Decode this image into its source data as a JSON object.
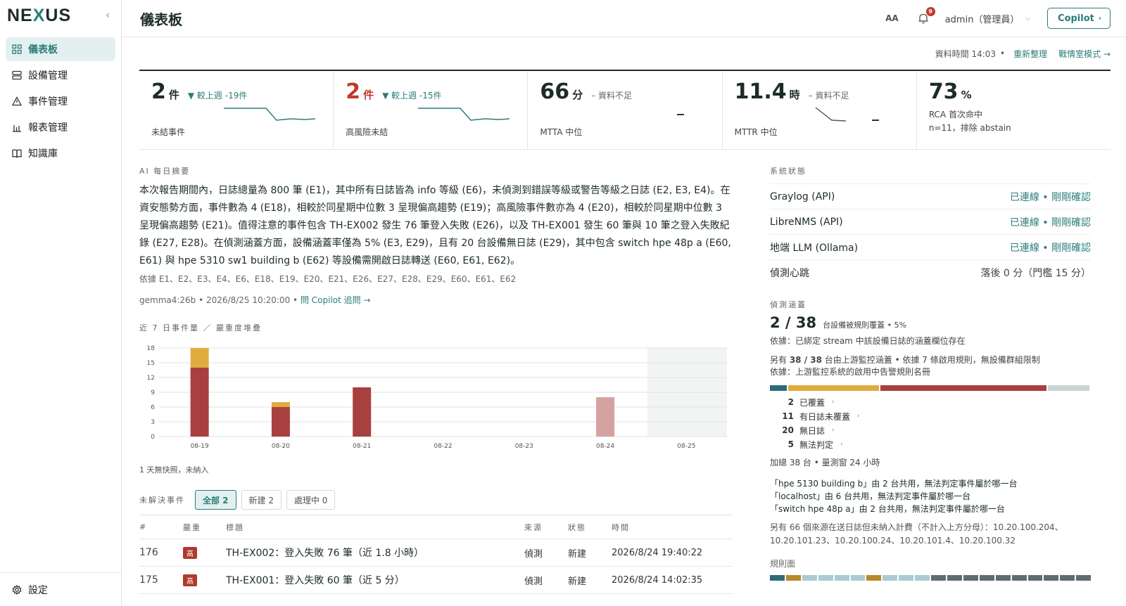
{
  "app": {
    "logo_prefix": "NE",
    "logo_x": "X",
    "logo_suffix": "US",
    "collapse_glyph": "‹"
  },
  "sidebar": {
    "items": [
      {
        "label": "儀表板",
        "icon": "grid-icon",
        "active": true
      },
      {
        "label": "設備管理",
        "icon": "server-icon"
      },
      {
        "label": "事件管理",
        "icon": "alert-triangle-icon"
      },
      {
        "label": "報表管理",
        "icon": "bar-chart-icon"
      },
      {
        "label": "知識庫",
        "icon": "book-icon"
      }
    ],
    "settings_label": "設定"
  },
  "header": {
    "title": "儀表板",
    "aa": "AA",
    "notification_count": "9",
    "user": "admin（管理員）",
    "copilot": "Copilot"
  },
  "toprow": {
    "data_time": "資料時間 14:03",
    "dot": "•",
    "refresh": "重新整理",
    "war_room": "戰情室模式 →"
  },
  "kpis": [
    {
      "value": "2",
      "unit": "件",
      "delta": "▼ 較上週 -19件",
      "label": "未結事件"
    },
    {
      "value": "2",
      "unit": "件",
      "delta": "▼ 較上週 -15件",
      "label": "高風險未結"
    },
    {
      "value": "66",
      "unit": "分",
      "delta": "– 資料不足",
      "label": "MTTA 中位"
    },
    {
      "value": "11.4",
      "unit": "時",
      "delta": "– 資料不足",
      "label": "MTTR 中位"
    },
    {
      "value": "73",
      "unit": "%",
      "label1": "RCA 首次命中",
      "label2": "n=11，排除 abstain"
    }
  ],
  "summary": {
    "title": "AI 每日摘要",
    "text": "本次報告期間內，日誌總量為 800 筆 (E1)，其中所有日誌皆為 info 等級 (E6)，未偵測到錯誤等級或警告等級之日誌 (E2, E3, E4)。在資安態勢方面，事件數為 4 (E18)，相較於同星期中位數 3 呈現偏高趨勢 (E19)；高風險事件數亦為 4 (E20)，相較於同星期中位數 3 呈現偏高趨勢 (E21)。值得注意的事件包含 TH-EX002 發生 76 筆登入失敗 (E26)，以及 TH-EX001 發生 60 筆與 10 筆之登入失敗紀錄 (E27, E28)。在偵測涵蓋方面，設備涵蓋率僅為 5% (E3, E29)，且有 20 台設備無日誌 (E29)，其中包含 switch hpe 48p a (E60, E61) 與 hpe 5310 sw1 building b (E62) 等設備需開啟日誌轉送 (E60, E61, E62)。",
    "basis": "依據 E1、E2、E3、E4、E6、E18、E19、E20、E21、E26、E27、E28、E29、E60、E61、E62",
    "meta": "gemma4:26b • 2026/8/25 10:20:00 • ",
    "ask": "問 Copilot 追問 →"
  },
  "chart_data": {
    "type": "bar",
    "title": "近 7 日事件量 ／ 嚴重度堆疊",
    "categories": [
      "08-19",
      "08-20",
      "08-21",
      "08-22",
      "08-23",
      "08-24",
      "08-25"
    ],
    "yticks": [
      0,
      3,
      6,
      9,
      12,
      15,
      18
    ],
    "ylim": [
      0,
      18
    ],
    "series": [
      {
        "color": "#a8403f",
        "values": [
          14,
          6,
          10,
          0,
          0,
          0,
          0
        ]
      },
      {
        "color": "#dfac3e",
        "values": [
          4,
          1,
          0,
          0,
          0,
          0,
          0
        ]
      },
      {
        "color": "#d4a3a1",
        "values": [
          0,
          0,
          0,
          0,
          0,
          8,
          0
        ]
      }
    ],
    "stacked": true,
    "note": "1 天無快照，未納入"
  },
  "incidents": {
    "title": "未解決事件",
    "filters": [
      {
        "label": "全部 2",
        "active": true
      },
      {
        "label": "新建 2"
      },
      {
        "label": "處理中 0"
      }
    ],
    "columns": [
      "#",
      "嚴重",
      "標題",
      "來源",
      "狀態",
      "時間"
    ],
    "rows": [
      {
        "id": "176",
        "sev": "高",
        "title": "TH-EX002：登入失敗 76 筆（近 1.8 小時）",
        "source": "偵測",
        "status": "新建",
        "time": "2026/8/24 19:40:22"
      },
      {
        "id": "175",
        "sev": "高",
        "title": "TH-EX001：登入失敗 60 筆（近 5 分）",
        "source": "偵測",
        "status": "新建",
        "time": "2026/8/24 14:02:35"
      }
    ]
  },
  "system": {
    "title": "系統狀態",
    "rows": [
      {
        "name": "Graylog (API)",
        "status": "已連線 • 剛剛確認",
        "ok": true
      },
      {
        "name": "LibreNMS (API)",
        "status": "已連線 • 剛剛確認",
        "ok": true
      },
      {
        "name": "地端 LLM (Ollama)",
        "status": "已連線 • 剛剛確認",
        "ok": true
      },
      {
        "name": "偵測心跳",
        "status": "落後 0 分（門檻 15 分）",
        "ok": false
      }
    ]
  },
  "coverage": {
    "title": "偵測涵蓋",
    "big": "2 / 38",
    "small": "台設備被規則覆蓋 • 5%",
    "basis": "依據：已綁定 stream 中該設備日誌的涵蓋欄位存在",
    "upstream_prefix": "另有 ",
    "upstream_bold": "38 / 38",
    "upstream_suffix": " 台由上游監控涵蓋 • 依據 7 條啟用規則，無設備群組限制",
    "upstream_basis": "依據：上游監控系統的啟用中告警規則名冊",
    "bar": [
      {
        "value": 2,
        "color": "#2f6b7a"
      },
      {
        "value": 11,
        "color": "#dfac3e"
      },
      {
        "value": 20,
        "color": "#a8403f"
      },
      {
        "value": 5,
        "color": "#c9d3d4"
      }
    ],
    "legend": [
      {
        "n": "2",
        "label": "已覆蓋"
      },
      {
        "n": "11",
        "label": "有日誌未覆蓋"
      },
      {
        "n": "20",
        "label": "無日誌"
      },
      {
        "n": "5",
        "label": "無法判定"
      }
    ],
    "total": "加總 38 台 • 量測窗 24 小時",
    "shared": [
      "「hpe 5130 building b」由 2 台共用，無法判定事件屬於哪一台",
      "「localhost」由 6 台共用，無法判定事件屬於哪一台",
      "「switch hpe 48p a」由 2 台共用，無法判定事件屬於哪一台"
    ],
    "unmeasured": "另有 66 個來源在送日誌但未納入計費（不計入上方分母）：10.20.100.204、10.20.101.23、10.20.100.24、10.20.101.4、10.20.100.32",
    "rules_title": "規則面",
    "rules_colors": [
      "#2f6b7a",
      "#b58a2c",
      "#a9cbd1",
      "#a9cbd1",
      "#a9cbd1",
      "#a9cbd1",
      "#b58a2c",
      "#a9cbd1",
      "#a9cbd1",
      "#a9cbd1",
      "#5f6d70",
      "#5f6d70",
      "#5f6d70",
      "#5f6d70",
      "#5f6d70",
      "#5f6d70",
      "#5f6d70",
      "#5f6d70",
      "#5f6d70",
      "#5f6d70"
    ]
  }
}
